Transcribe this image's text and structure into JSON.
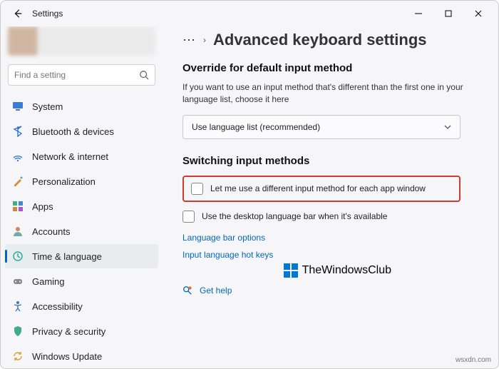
{
  "title": "Settings",
  "search": {
    "placeholder": "Find a setting"
  },
  "nav": {
    "system": "System",
    "bluetooth": "Bluetooth & devices",
    "network": "Network & internet",
    "personalization": "Personalization",
    "apps": "Apps",
    "accounts": "Accounts",
    "time": "Time & language",
    "gaming": "Gaming",
    "accessibility": "Accessibility",
    "privacy": "Privacy & security",
    "update": "Windows Update"
  },
  "page": {
    "title": "Advanced keyboard settings",
    "section1": "Override for default input method",
    "section1_desc": "If you want to use an input method that's different than the first one in your language list, choose it here",
    "select_value": "Use language list (recommended)",
    "section2": "Switching input methods",
    "chk1": "Let me use a different input method for each app window",
    "chk2": "Use the desktop language bar when it's available",
    "link1": "Language bar options",
    "link2": "Input language hot keys",
    "help": "Get help"
  },
  "branding": "TheWindowsClub",
  "watermark": "wsxdn.com"
}
